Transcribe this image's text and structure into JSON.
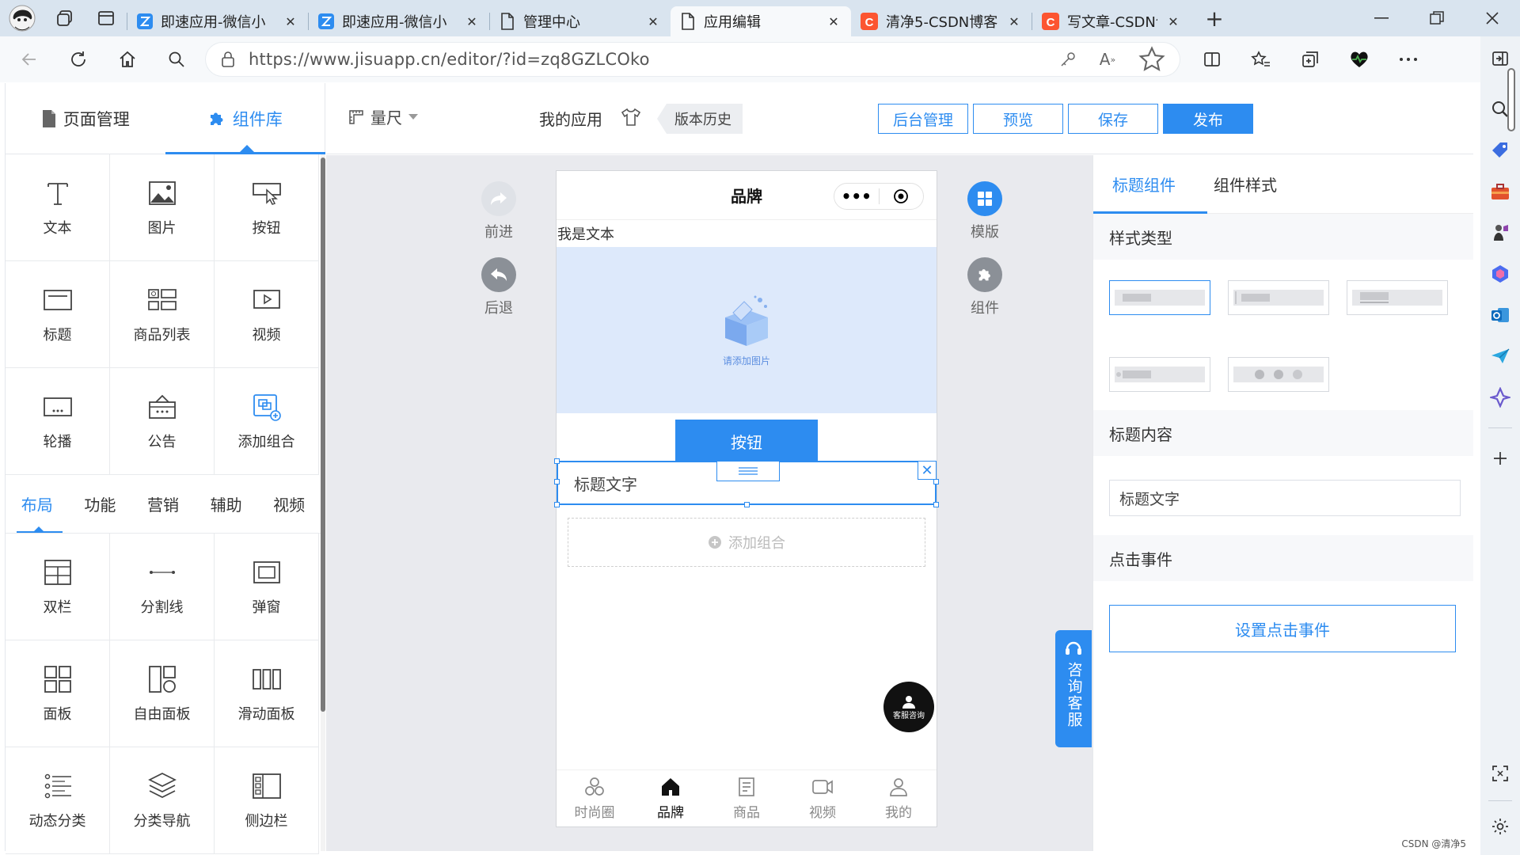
{
  "browser": {
    "tabs": [
      {
        "title": "即速应用-微信小",
        "icon": "jisuapp-icon",
        "active": false
      },
      {
        "title": "即速应用-微信小",
        "icon": "jisuapp-icon",
        "active": false
      },
      {
        "title": "管理中心",
        "icon": "page-icon",
        "active": false
      },
      {
        "title": "应用编辑",
        "icon": "page-icon",
        "active": true
      },
      {
        "title": "清净5-CSDN博客",
        "icon": "csdn-icon",
        "active": false
      },
      {
        "title": "写文章-CSDN创作",
        "icon": "csdn-icon",
        "active": false
      }
    ],
    "url": "https://www.jisuapp.cn/editor/?id=zq8GZLCOko",
    "accent_color": "#2d8cf0"
  },
  "left_panel": {
    "tabs": [
      {
        "label": "页面管理",
        "icon": "page-icon"
      },
      {
        "label": "组件库",
        "icon": "puzzle-icon",
        "active": true
      }
    ],
    "basic_components": [
      {
        "label": "文本",
        "icon": "text-icon"
      },
      {
        "label": "图片",
        "icon": "image-icon"
      },
      {
        "label": "按钮",
        "icon": "button-icon"
      },
      {
        "label": "标题",
        "icon": "title-icon"
      },
      {
        "label": "商品列表",
        "icon": "goods-list-icon"
      },
      {
        "label": "视频",
        "icon": "video-icon"
      },
      {
        "label": "轮播",
        "icon": "carousel-icon"
      },
      {
        "label": "公告",
        "icon": "notice-icon"
      },
      {
        "label": "添加组合",
        "icon": "add-combo-icon"
      }
    ],
    "categories": [
      "布局",
      "功能",
      "营销",
      "辅助",
      "视频"
    ],
    "active_category": "布局",
    "layout_components": [
      {
        "label": "双栏",
        "icon": "two-column-icon"
      },
      {
        "label": "分割线",
        "icon": "divider-icon"
      },
      {
        "label": "弹窗",
        "icon": "popup-icon"
      },
      {
        "label": "面板",
        "icon": "panel-icon"
      },
      {
        "label": "自由面板",
        "icon": "free-panel-icon"
      },
      {
        "label": "滑动面板",
        "icon": "slide-panel-icon"
      },
      {
        "label": "动态分类",
        "icon": "dynamic-category-icon"
      },
      {
        "label": "分类导航",
        "icon": "category-nav-icon"
      },
      {
        "label": "侧边栏",
        "icon": "sidebar-icon"
      }
    ]
  },
  "toolbar": {
    "ruler_label": "量尺",
    "app_label": "我的应用",
    "version_history": "版本历史",
    "backend_button": "后台管理",
    "preview_button": "预览",
    "save_button": "保存",
    "publish_button": "发布"
  },
  "canvas": {
    "forward": "前进",
    "back": "后退",
    "template": "模版",
    "components": "组件",
    "consult": "咨询客服"
  },
  "phone": {
    "title": "品牌",
    "text": "我是文本",
    "image_placeholder": "请添加图片",
    "button": "按钮",
    "title_text": "标题文字",
    "add_combo": "添加组合",
    "service": "客服咨询",
    "nav": [
      {
        "label": "时尚圈",
        "icon": "circles-icon"
      },
      {
        "label": "品牌",
        "icon": "home-icon",
        "active": true
      },
      {
        "label": "商品",
        "icon": "goods-icon"
      },
      {
        "label": "视频",
        "icon": "video-icon"
      },
      {
        "label": "我的",
        "icon": "user-icon"
      }
    ]
  },
  "right_panel": {
    "tabs": [
      "标题组件",
      "组件样式"
    ],
    "style_type_label": "样式类型",
    "content_label": "标题内容",
    "content_value": "标题文字",
    "event_label": "点击事件",
    "event_button": "设置点击事件"
  },
  "watermark": "CSDN @清净5"
}
